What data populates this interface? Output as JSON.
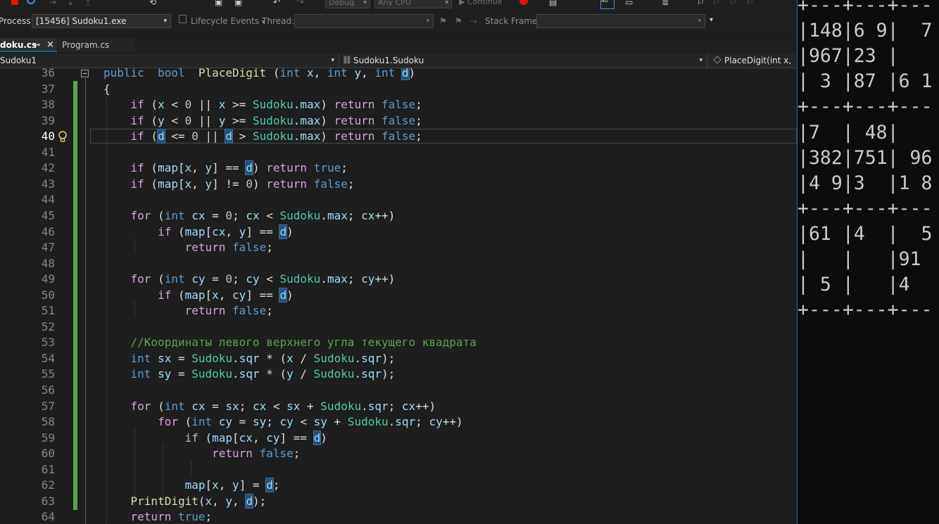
{
  "toolbar": {
    "config": "Debug",
    "platform": "Any CPU",
    "continue_label": "Continue"
  },
  "process_bar": {
    "process_label": "Process:",
    "process_value": "[15456] Sudoku1.exe",
    "lifecycle_label": "Lifecycle Events",
    "thread_label": "Thread:",
    "thread_value": "",
    "stackframe_label": "Stack Frame:",
    "stackframe_value": ""
  },
  "tabs": [
    {
      "label": "doku.cs",
      "pin": "⊸",
      "close": "×",
      "active": true
    },
    {
      "label": "Program.cs",
      "active": false
    }
  ],
  "navbar": {
    "project": "Sudoku1",
    "class": "Sudoku1.Sudoku",
    "member": "PlaceDigit(int x, int"
  },
  "editor": {
    "current_line": 40,
    "lines": [
      {
        "num": "36"
      },
      {
        "num": "37"
      },
      {
        "num": "38"
      },
      {
        "num": "39"
      },
      {
        "num": "40"
      },
      {
        "num": "41"
      },
      {
        "num": "42"
      },
      {
        "num": "43"
      },
      {
        "num": "44"
      },
      {
        "num": "45"
      },
      {
        "num": "46"
      },
      {
        "num": "47"
      },
      {
        "num": "48"
      },
      {
        "num": "49"
      },
      {
        "num": "50"
      },
      {
        "num": "51"
      },
      {
        "num": "52"
      },
      {
        "num": "53"
      },
      {
        "num": "54"
      },
      {
        "num": "55"
      },
      {
        "num": "56"
      },
      {
        "num": "57"
      },
      {
        "num": "58"
      },
      {
        "num": "59"
      },
      {
        "num": "60"
      },
      {
        "num": "61"
      },
      {
        "num": "62"
      },
      {
        "num": "63"
      },
      {
        "num": "64"
      }
    ],
    "code": [
      [
        [
          "kw",
          "public"
        ],
        [
          "",
          "  "
        ],
        [
          "kw",
          "bool"
        ],
        [
          "",
          "  "
        ],
        [
          "fn",
          "PlaceDigit"
        ],
        [
          "",
          " ("
        ],
        [
          "kw",
          "int"
        ],
        [
          "",
          " "
        ],
        [
          "var",
          "x"
        ],
        [
          ", "
        ],
        [
          "kw",
          "int"
        ],
        [
          "",
          " "
        ],
        [
          "var",
          "y"
        ],
        [
          ", "
        ],
        [
          "kw",
          "int"
        ],
        [
          "",
          " "
        ],
        [
          "par",
          "d"
        ],
        [
          "",
          ")"
        ]
      ],
      [
        [
          "",
          "{"
        ]
      ],
      [
        [
          "",
          "    "
        ],
        [
          "ctl",
          "if"
        ],
        [
          "",
          " ("
        ],
        [
          "var",
          "x"
        ],
        [
          "",
          " < "
        ],
        [
          "nm",
          "0"
        ],
        [
          "",
          " || "
        ],
        [
          "var",
          "x"
        ],
        [
          "",
          " >= "
        ],
        [
          "ty",
          "Sudoku"
        ],
        [
          "",
          "."
        ],
        [
          "var",
          "max"
        ],
        [
          "",
          ") "
        ],
        [
          "ctl",
          "return"
        ],
        [
          "",
          " "
        ],
        [
          "kw",
          "false"
        ],
        [
          "",
          ";"
        ]
      ],
      [
        [
          "",
          "    "
        ],
        [
          "ctl",
          "if"
        ],
        [
          "",
          " ("
        ],
        [
          "var",
          "y"
        ],
        [
          "",
          " < "
        ],
        [
          "nm",
          "0"
        ],
        [
          "",
          " || "
        ],
        [
          "var",
          "y"
        ],
        [
          "",
          " >= "
        ],
        [
          "ty",
          "Sudoku"
        ],
        [
          "",
          "."
        ],
        [
          "var",
          "max"
        ],
        [
          "",
          ") "
        ],
        [
          "ctl",
          "return"
        ],
        [
          "",
          " "
        ],
        [
          "kw",
          "false"
        ],
        [
          "",
          ";"
        ]
      ],
      [
        [
          "",
          "    "
        ],
        [
          "ctl",
          "if"
        ],
        [
          "",
          " ("
        ],
        [
          "par",
          "d"
        ],
        [
          "",
          " <= "
        ],
        [
          "nm",
          "0"
        ],
        [
          "",
          " || "
        ],
        [
          "par",
          "d"
        ],
        [
          "",
          " > "
        ],
        [
          "ty",
          "Sudoku"
        ],
        [
          "",
          "."
        ],
        [
          "var",
          "max"
        ],
        [
          "",
          ") "
        ],
        [
          "ctl",
          "return"
        ],
        [
          "",
          " "
        ],
        [
          "kw",
          "false"
        ],
        [
          "",
          ";"
        ]
      ],
      [
        [
          "",
          ""
        ]
      ],
      [
        [
          "",
          "    "
        ],
        [
          "ctl",
          "if"
        ],
        [
          "",
          " ("
        ],
        [
          "var",
          "map"
        ],
        [
          "",
          "["
        ],
        [
          "var",
          "x"
        ],
        [
          "",
          ", "
        ],
        [
          "var",
          "y"
        ],
        [
          "",
          "] == "
        ],
        [
          "par",
          "d"
        ],
        [
          "",
          ") "
        ],
        [
          "ctl",
          "return"
        ],
        [
          "",
          " "
        ],
        [
          "kw",
          "true"
        ],
        [
          "",
          ";"
        ]
      ],
      [
        [
          "",
          "    "
        ],
        [
          "ctl",
          "if"
        ],
        [
          "",
          " ("
        ],
        [
          "var",
          "map"
        ],
        [
          "",
          "["
        ],
        [
          "var",
          "x"
        ],
        [
          "",
          ", "
        ],
        [
          "var",
          "y"
        ],
        [
          "",
          "] != "
        ],
        [
          "nm",
          "0"
        ],
        [
          "",
          ") "
        ],
        [
          "ctl",
          "return"
        ],
        [
          "",
          " "
        ],
        [
          "kw",
          "false"
        ],
        [
          "",
          ";"
        ]
      ],
      [
        [
          "",
          ""
        ]
      ],
      [
        [
          "",
          "    "
        ],
        [
          "ctl",
          "for"
        ],
        [
          "",
          " ("
        ],
        [
          "kw",
          "int"
        ],
        [
          "",
          " "
        ],
        [
          "var",
          "cx"
        ],
        [
          "",
          " = "
        ],
        [
          "nm",
          "0"
        ],
        [
          "",
          "; "
        ],
        [
          "var",
          "cx"
        ],
        [
          "",
          " < "
        ],
        [
          "ty",
          "Sudoku"
        ],
        [
          "",
          "."
        ],
        [
          "var",
          "max"
        ],
        [
          "",
          "; "
        ],
        [
          "var",
          "cx"
        ],
        [
          "",
          "++)"
        ]
      ],
      [
        [
          "",
          "        "
        ],
        [
          "ctl",
          "if"
        ],
        [
          "",
          " ("
        ],
        [
          "var",
          "map"
        ],
        [
          "",
          "["
        ],
        [
          "var",
          "cx"
        ],
        [
          "",
          ", "
        ],
        [
          "var",
          "y"
        ],
        [
          "",
          "] == "
        ],
        [
          "par",
          "d"
        ],
        [
          "",
          ")"
        ]
      ],
      [
        [
          "",
          "            "
        ],
        [
          "ctl",
          "return"
        ],
        [
          "",
          " "
        ],
        [
          "kw",
          "false"
        ],
        [
          "",
          ";"
        ]
      ],
      [
        [
          "",
          ""
        ]
      ],
      [
        [
          "",
          "    "
        ],
        [
          "ctl",
          "for"
        ],
        [
          "",
          " ("
        ],
        [
          "kw",
          "int"
        ],
        [
          "",
          " "
        ],
        [
          "var",
          "cy"
        ],
        [
          "",
          " = "
        ],
        [
          "nm",
          "0"
        ],
        [
          "",
          "; "
        ],
        [
          "var",
          "cy"
        ],
        [
          "",
          " < "
        ],
        [
          "ty",
          "Sudoku"
        ],
        [
          "",
          "."
        ],
        [
          "var",
          "max"
        ],
        [
          "",
          "; "
        ],
        [
          "var",
          "cy"
        ],
        [
          "",
          "++)"
        ]
      ],
      [
        [
          "",
          "        "
        ],
        [
          "ctl",
          "if"
        ],
        [
          "",
          " ("
        ],
        [
          "var",
          "map"
        ],
        [
          "",
          "["
        ],
        [
          "var",
          "x"
        ],
        [
          "",
          ", "
        ],
        [
          "var",
          "cy"
        ],
        [
          "",
          "] == "
        ],
        [
          "par",
          "d"
        ],
        [
          "",
          ")"
        ]
      ],
      [
        [
          "",
          "            "
        ],
        [
          "ctl",
          "return"
        ],
        [
          "",
          " "
        ],
        [
          "kw",
          "false"
        ],
        [
          "",
          ";"
        ]
      ],
      [
        [
          "",
          ""
        ]
      ],
      [
        [
          "",
          "    "
        ],
        [
          "cm",
          "//Координаты левого верхнего угла текущего квадрата"
        ]
      ],
      [
        [
          "",
          "    "
        ],
        [
          "kw",
          "int"
        ],
        [
          "",
          " "
        ],
        [
          "var",
          "sx"
        ],
        [
          "",
          " = "
        ],
        [
          "ty",
          "Sudoku"
        ],
        [
          "",
          "."
        ],
        [
          "var",
          "sqr"
        ],
        [
          "",
          " * ("
        ],
        [
          "var",
          "x"
        ],
        [
          "",
          " / "
        ],
        [
          "ty",
          "Sudoku"
        ],
        [
          "",
          "."
        ],
        [
          "var",
          "sqr"
        ],
        [
          "",
          ");"
        ]
      ],
      [
        [
          "",
          "    "
        ],
        [
          "kw",
          "int"
        ],
        [
          "",
          " "
        ],
        [
          "var",
          "sy"
        ],
        [
          "",
          " = "
        ],
        [
          "ty",
          "Sudoku"
        ],
        [
          "",
          "."
        ],
        [
          "var",
          "sqr"
        ],
        [
          "",
          " * ("
        ],
        [
          "var",
          "y"
        ],
        [
          "",
          " / "
        ],
        [
          "ty",
          "Sudoku"
        ],
        [
          "",
          "."
        ],
        [
          "var",
          "sqr"
        ],
        [
          "",
          ");"
        ]
      ],
      [
        [
          "",
          ""
        ]
      ],
      [
        [
          "",
          "    "
        ],
        [
          "ctl",
          "for"
        ],
        [
          "",
          " ("
        ],
        [
          "kw",
          "int"
        ],
        [
          "",
          " "
        ],
        [
          "var",
          "cx"
        ],
        [
          "",
          " = "
        ],
        [
          "var",
          "sx"
        ],
        [
          "",
          "; "
        ],
        [
          "var",
          "cx"
        ],
        [
          "",
          " < "
        ],
        [
          "var",
          "sx"
        ],
        [
          "",
          " + "
        ],
        [
          "ty",
          "Sudoku"
        ],
        [
          "",
          "."
        ],
        [
          "var",
          "sqr"
        ],
        [
          "",
          "; "
        ],
        [
          "var",
          "cx"
        ],
        [
          "",
          "++)"
        ]
      ],
      [
        [
          "",
          "        "
        ],
        [
          "ctl",
          "for"
        ],
        [
          "",
          " ("
        ],
        [
          "kw",
          "int"
        ],
        [
          "",
          " "
        ],
        [
          "var",
          "cy"
        ],
        [
          "",
          " = "
        ],
        [
          "var",
          "sy"
        ],
        [
          "",
          "; "
        ],
        [
          "var",
          "cy"
        ],
        [
          "",
          " < "
        ],
        [
          "var",
          "sy"
        ],
        [
          "",
          " + "
        ],
        [
          "ty",
          "Sudoku"
        ],
        [
          "",
          "."
        ],
        [
          "var",
          "sqr"
        ],
        [
          "",
          "; "
        ],
        [
          "var",
          "cy"
        ],
        [
          "",
          "++)"
        ]
      ],
      [
        [
          "",
          "            "
        ],
        [
          "ctl",
          "if"
        ],
        [
          "",
          " ("
        ],
        [
          "var",
          "map"
        ],
        [
          "",
          "["
        ],
        [
          "var",
          "cx"
        ],
        [
          "",
          ", "
        ],
        [
          "var",
          "cy"
        ],
        [
          "",
          "] == "
        ],
        [
          "par",
          "d"
        ],
        [
          "",
          ")"
        ]
      ],
      [
        [
          "",
          "                "
        ],
        [
          "ctl",
          "return"
        ],
        [
          "",
          " "
        ],
        [
          "kw",
          "false"
        ],
        [
          "",
          ";"
        ]
      ],
      [
        [
          "",
          ""
        ]
      ],
      [
        [
          "",
          "            "
        ],
        [
          "var",
          "map"
        ],
        [
          "",
          "["
        ],
        [
          "var",
          "x"
        ],
        [
          "",
          ", "
        ],
        [
          "var",
          "y"
        ],
        [
          "",
          "] = "
        ],
        [
          "par",
          "d"
        ],
        [
          "",
          ";"
        ]
      ],
      [
        [
          "",
          "    "
        ],
        [
          "fn",
          "PrintDigit"
        ],
        [
          "",
          "("
        ],
        [
          "var",
          "x"
        ],
        [
          "",
          ", "
        ],
        [
          "var",
          "y"
        ],
        [
          "",
          ", "
        ],
        [
          "par",
          "d"
        ],
        [
          "",
          ");"
        ]
      ],
      [
        [
          "",
          "    "
        ],
        [
          "ctl",
          "return"
        ],
        [
          "",
          " "
        ],
        [
          "kw",
          "true"
        ],
        [
          "",
          ";"
        ]
      ]
    ]
  },
  "console": {
    "lines": [
      "+---+---+---",
      "|148|6 9|  7",
      "|967|23 |   ",
      "| 3 |87 |6 1",
      "+---+---+---",
      "|7  | 48|   ",
      "|382|751| 96",
      "|4 9|3  |1 8",
      "+---+---+---",
      "|61 |4  |  5",
      "|   |   |91 ",
      "| 5 |   |4  ",
      "+---+---+---"
    ]
  }
}
